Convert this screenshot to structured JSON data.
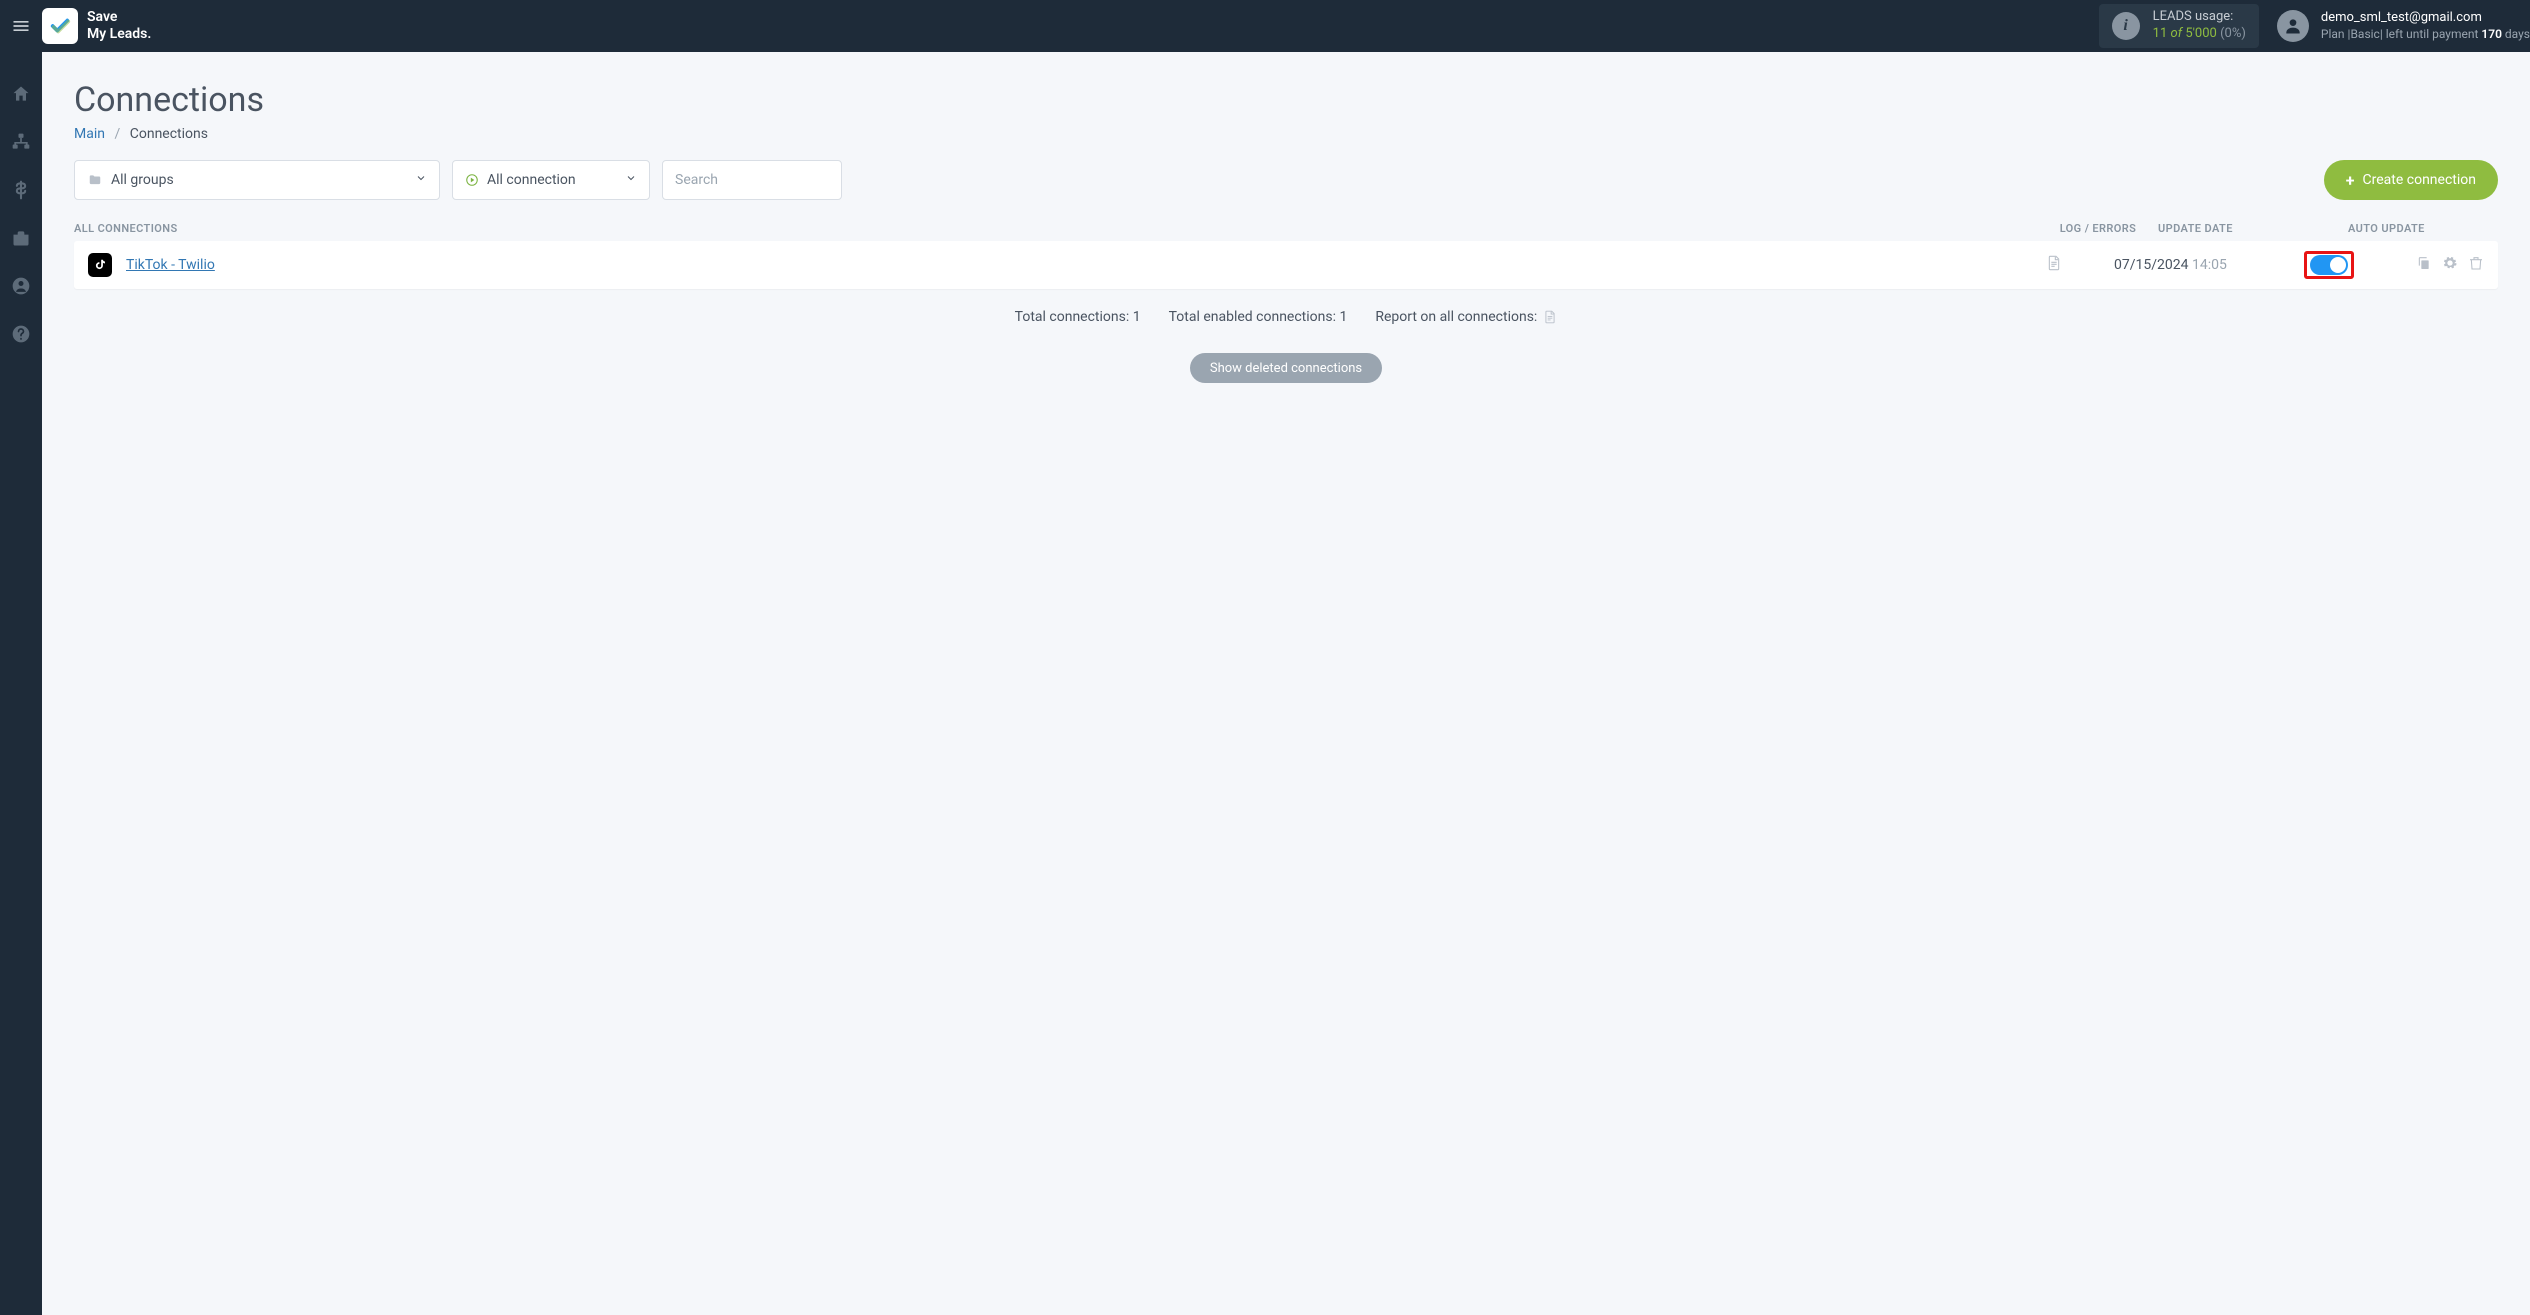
{
  "brand": {
    "line1": "Save",
    "line2": "My Leads."
  },
  "leads_usage": {
    "label": "LEADS usage:",
    "count": "11",
    "of": "of",
    "total": "5'000",
    "pct": "(0%)"
  },
  "account": {
    "email": "demo_sml_test@gmail.com",
    "plan_prefix": "Plan |",
    "plan_name": "Basic",
    "plan_mid": "| left until payment ",
    "days": "170",
    "days_suffix": " days"
  },
  "page": {
    "title": "Connections"
  },
  "breadcrumb": {
    "main": "Main",
    "sep": "/",
    "current": "Connections"
  },
  "filters": {
    "groups_label": "All groups",
    "status_label": "All connection",
    "search_placeholder": "Search",
    "create_label": "Create connection"
  },
  "table": {
    "head_connections": "ALL CONNECTIONS",
    "head_log": "LOG / ERRORS",
    "head_date": "UPDATE DATE",
    "head_auto": "AUTO UPDATE"
  },
  "rows": [
    {
      "name": "TikTok - Twilio",
      "date": "07/15/2024",
      "time": "14:05",
      "auto_update_on": true
    }
  ],
  "summary": {
    "total_connections": "Total connections: 1",
    "total_enabled": "Total enabled connections: 1",
    "report_label": "Report on all connections:"
  },
  "show_deleted": "Show deleted connections"
}
